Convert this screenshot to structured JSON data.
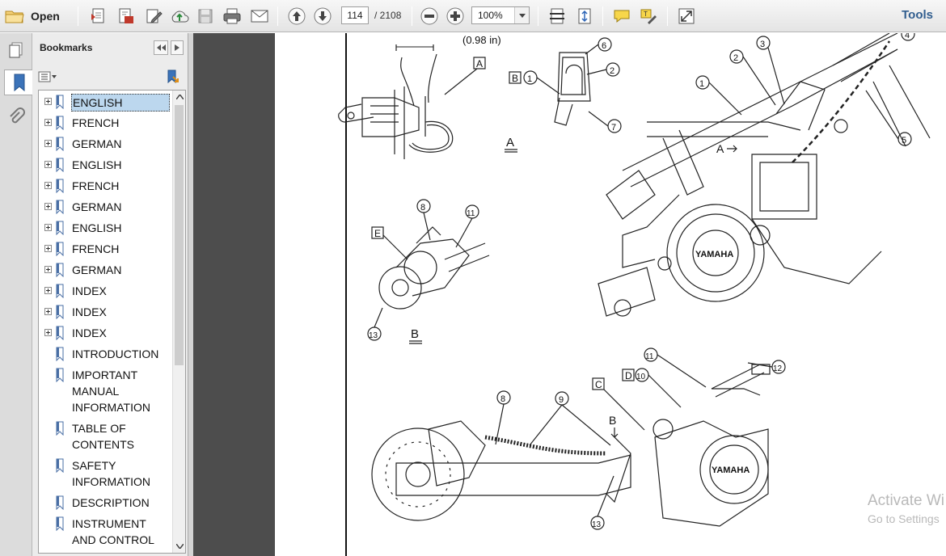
{
  "toolbar": {
    "open_label": "Open",
    "current_page": "114",
    "total_pages": "/ 2108",
    "zoom": "100%",
    "tools_label": "Tools"
  },
  "bookmarks": {
    "title": "Bookmarks",
    "items": [
      {
        "label": "ENGLISH",
        "expandable": true,
        "selected": true
      },
      {
        "label": "FRENCH",
        "expandable": true
      },
      {
        "label": "GERMAN",
        "expandable": true
      },
      {
        "label": "ENGLISH",
        "expandable": true
      },
      {
        "label": "FRENCH",
        "expandable": true
      },
      {
        "label": "GERMAN",
        "expandable": true
      },
      {
        "label": "ENGLISH",
        "expandable": true
      },
      {
        "label": "FRENCH",
        "expandable": true
      },
      {
        "label": "GERMAN",
        "expandable": true
      },
      {
        "label": "INDEX",
        "expandable": true
      },
      {
        "label": "INDEX",
        "expandable": true
      },
      {
        "label": "INDEX",
        "expandable": true
      },
      {
        "label": "INTRODUCTION",
        "expandable": false
      },
      {
        "label": "IMPORTANT MANUAL INFORMATION",
        "expandable": false
      },
      {
        "label": "TABLE OF CONTENTS",
        "expandable": false
      },
      {
        "label": "SAFETY INFORMATION",
        "expandable": false
      },
      {
        "label": "DESCRIPTION",
        "expandable": false
      },
      {
        "label": "INSTRUMENT AND CONTROL",
        "expandable": false
      }
    ]
  },
  "diagram": {
    "dimension_label": "(0.98 in)",
    "view_labels": [
      "A",
      "B"
    ],
    "callouts": [
      "1",
      "2",
      "3",
      "4",
      "5",
      "6",
      "7",
      "8",
      "9",
      "10",
      "11",
      "12",
      "13"
    ],
    "box_letters": [
      "A",
      "B",
      "C",
      "D",
      "E"
    ],
    "arrow_letters": [
      "A",
      "B"
    ],
    "brand_text": "YAMAHA"
  },
  "watermark": {
    "line1": "Activate Wi",
    "line2": "Go to Settings"
  }
}
